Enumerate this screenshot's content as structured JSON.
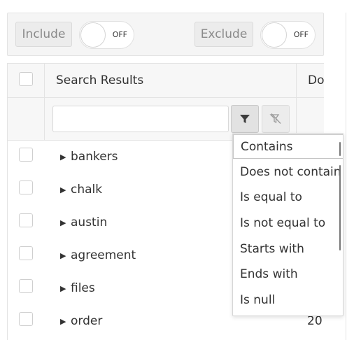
{
  "toolbar": {
    "include_label": "Include",
    "include_toggle_state": "OFF",
    "exclude_label": "Exclude",
    "exclude_toggle_state": "OFF"
  },
  "grid": {
    "header": {
      "results_title": "Search Results",
      "next_column": "Do"
    },
    "filter": {
      "input_value": ""
    },
    "rows": [
      {
        "label": "bankers",
        "extra": ""
      },
      {
        "label": "chalk",
        "extra": ""
      },
      {
        "label": "austin",
        "extra": ""
      },
      {
        "label": "agreement",
        "extra": ""
      },
      {
        "label": "files",
        "extra": ""
      },
      {
        "label": "order",
        "extra": "20"
      }
    ],
    "expander_glyph": "▶"
  },
  "filter_operators": {
    "selected": "Contains",
    "options": [
      "Contains",
      "Does not contain",
      "Is equal to",
      "Is not equal to",
      "Starts with",
      "Ends with",
      "Is null"
    ]
  },
  "icons": {
    "filter": "funnel-icon",
    "clear_filter": "clear-filter-icon"
  },
  "colors": {
    "header_background": "#f7f7f7",
    "border": "#e3e3e3",
    "text": "#333333",
    "muted_text": "#8a8a8a"
  }
}
